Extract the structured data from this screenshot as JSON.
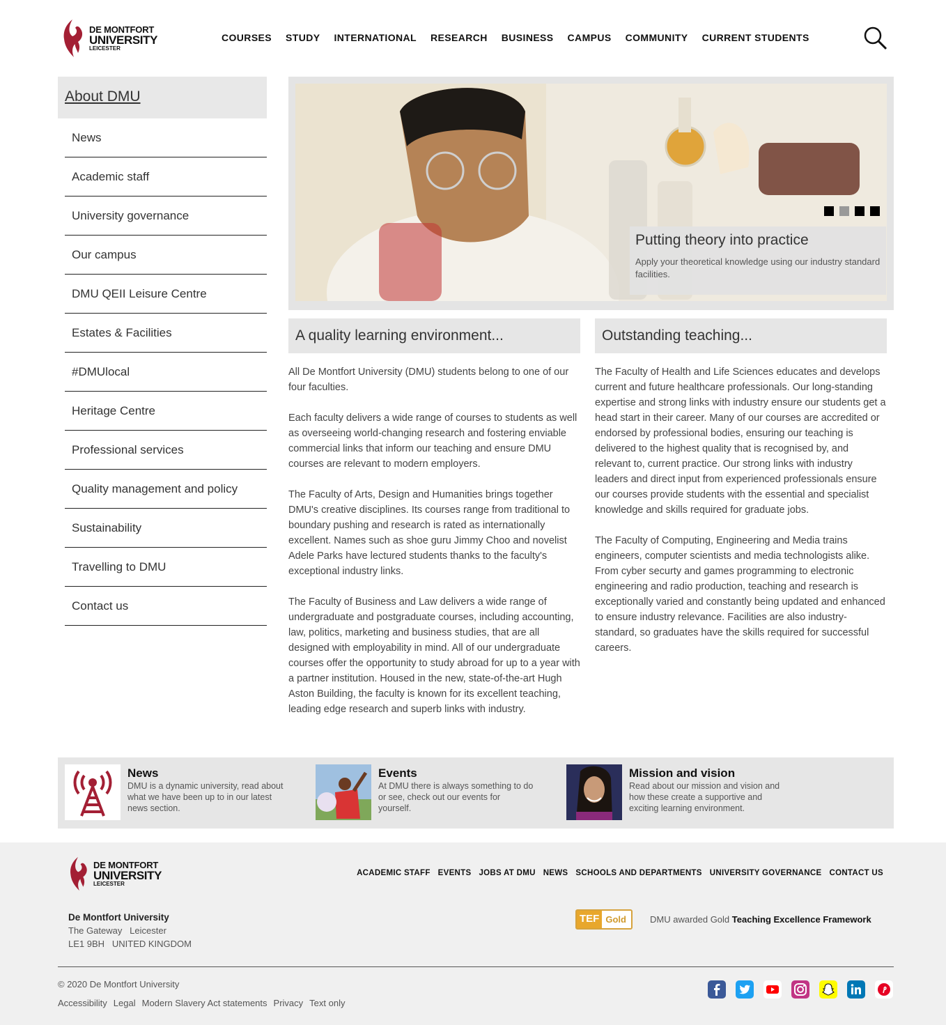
{
  "header": {
    "logo": {
      "line1": "DE MONTFORT",
      "line2": "UNIVERSITY",
      "line3": "LEICESTER"
    },
    "nav": [
      "COURSES",
      "STUDY",
      "INTERNATIONAL",
      "RESEARCH",
      "BUSINESS",
      "CAMPUS",
      "COMMUNITY",
      "CURRENT STUDENTS"
    ],
    "search_icon": "search-icon"
  },
  "sidebar": {
    "title": "About DMU",
    "items": [
      {
        "label": "News"
      },
      {
        "label": "Academic staff"
      },
      {
        "label": "University governance"
      },
      {
        "label": "Our campus"
      },
      {
        "label": "DMU QEII Leisure Centre"
      },
      {
        "label": "Estates & Facilities"
      },
      {
        "label": "#DMUlocal"
      },
      {
        "label": "Heritage Centre"
      },
      {
        "label": "Professional services"
      },
      {
        "label": "Quality management and policy"
      },
      {
        "label": "Sustainability"
      },
      {
        "label": "Travelling to DMU"
      },
      {
        "label": "Contact us"
      }
    ]
  },
  "hero": {
    "caption_title": "Putting theory into practice",
    "caption_text": "Apply your theoretical knowledge using our industry standard facilities.",
    "slides": 4,
    "active_slide": 2
  },
  "left_column": {
    "heading": "A quality learning environment...",
    "paragraphs": [
      "All De Montfort University (DMU) students belong to one of our four faculties.",
      "Each faculty delivers a wide range of courses to students as well as overseeing world-changing research and fostering enviable commercial links that inform our teaching and ensure DMU courses are relevant to modern employers.",
      "The Faculty of Arts, Design and Humanities brings together DMU's creative disciplines. Its courses range from traditional to boundary pushing and research is rated as internationally excellent. Names such as shoe guru Jimmy Choo and novelist Adele Parks have lectured students thanks to the faculty's exceptional industry links.",
      "The Faculty of Business and Law delivers a wide range of undergraduate and postgraduate courses, including accounting, law, politics, marketing and business studies, that are all designed with employability in mind. All of our undergraduate courses offer the opportunity to study abroad for up to a year with a partner institution. Housed in the new, state-of-the-art Hugh Aston Building, the faculty is known for its excellent teaching, leading edge research and superb links with industry."
    ]
  },
  "right_column": {
    "heading": "Outstanding teaching...",
    "paragraphs": [
      "The Faculty of Health and Life Sciences educates and develops current and future healthcare professionals. Our long-standing expertise and strong links with industry ensure our students get a head start in their career. Many of our courses are accredited or endorsed by professional bodies, ensuring our teaching is delivered to the highest quality that is recognised by, and relevant to, current practice. Our strong links with industry leaders and direct input from experienced professionals ensure our courses provide students with the essential and specialist knowledge and skills required for graduate jobs.",
      "The Faculty of Computing, Engineering and Media trains engineers, computer scientists and media technologists alike. From cyber securty and games programming to electronic engineering and radio production, teaching and research is exceptionally varied and constantly being updated and enhanced to ensure industry relevance. Facilities are also industry-standard, so graduates have the skills required for successful careers."
    ]
  },
  "promos": [
    {
      "title": "News",
      "text": "DMU is a dynamic university, read about what we have been up to in our latest news section."
    },
    {
      "title": "Events",
      "text": "At DMU there is always something to do or see, check out our events for yourself."
    },
    {
      "title": "Mission and vision",
      "text": "Read about our mission and vision and how these create a supportive and exciting learning environment."
    }
  ],
  "footer": {
    "links": [
      "ACADEMIC STAFF",
      "EVENTS",
      "JOBS AT DMU",
      "NEWS",
      "SCHOOLS AND DEPARTMENTS",
      "UNIVERSITY GOVERNANCE",
      "CONTACT US"
    ],
    "address": {
      "name": "De Montfort University",
      "line1": "The Gateway   Leicester",
      "line2": "LE1 9BH   UNITED KINGDOM"
    },
    "tef": {
      "badge_1": "TEF",
      "badge_2": "Gold",
      "text_prefix": "DMU awarded Gold",
      "text_bold": "Teaching Excellence Framework"
    },
    "copyright": "© 2020 De Montfort University",
    "legal": [
      "Accessibility",
      "Legal",
      "Modern Slavery Act statements",
      "Privacy",
      "Text only"
    ],
    "social": [
      {
        "name": "facebook-icon",
        "color": "#3b5998"
      },
      {
        "name": "twitter-icon",
        "color": "#1da1f2"
      },
      {
        "name": "youtube-icon",
        "color": "#ff0000"
      },
      {
        "name": "instagram-icon",
        "color": "#c13584"
      },
      {
        "name": "snapchat-icon",
        "color": "#fffc00"
      },
      {
        "name": "linkedin-icon",
        "color": "#0077b5"
      },
      {
        "name": "pinterest-icon",
        "color": "#e60023"
      }
    ]
  },
  "colors": {
    "brand_red": "#a31f34",
    "panel_gray": "#e6e6e6",
    "footer_gray": "#f0f0f0"
  }
}
